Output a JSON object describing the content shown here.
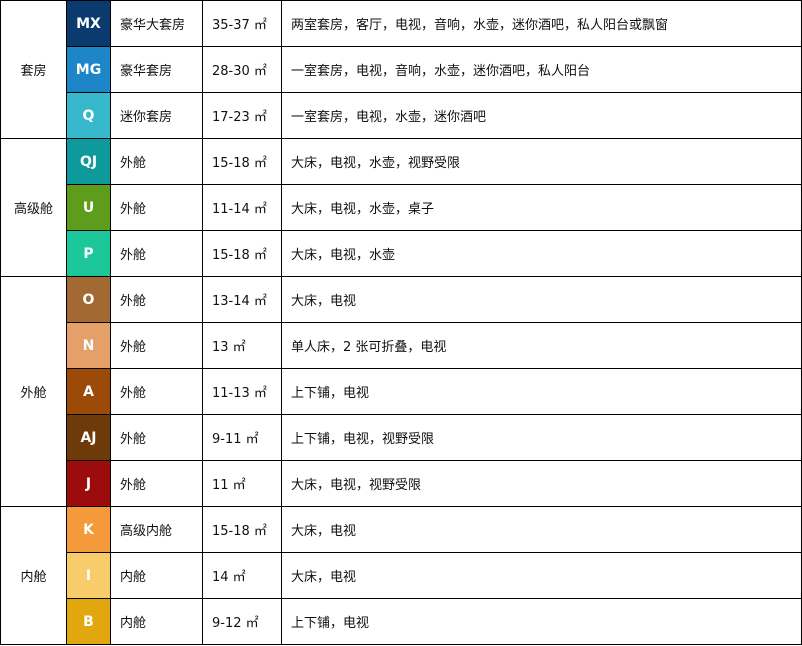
{
  "table": {
    "groups": [
      {
        "category": "套房",
        "rows": [
          {
            "code": "MX",
            "color": "#0b3a6e",
            "type": "豪华大套房",
            "size": "35-37 ㎡",
            "features": "两室套房，客厅，电视，音响，水壶，迷你酒吧，私人阳台或飘窗"
          },
          {
            "code": "MG",
            "color": "#1d86c8",
            "type": "豪华套房",
            "size": "28-30 ㎡",
            "features": "一室套房，电视，音响，水壶，迷你酒吧，私人阳台"
          },
          {
            "code": "Q",
            "color": "#38b8cc",
            "type": "迷你套房",
            "size": "17-23 ㎡",
            "features": "一室套房，电视，水壶，迷你酒吧"
          }
        ]
      },
      {
        "category": "高级舱",
        "rows": [
          {
            "code": "QJ",
            "color": "#0e9a9c",
            "type": "外舱",
            "size": "15-18 ㎡",
            "features": "大床，电视，水壶，视野受限"
          },
          {
            "code": "U",
            "color": "#5e9c1c",
            "type": "外舱",
            "size": "11-14 ㎡",
            "features": "大床，电视，水壶，桌子"
          },
          {
            "code": "P",
            "color": "#1cc89a",
            "type": "外舱",
            "size": "15-18 ㎡",
            "features": "大床，电视，水壶"
          }
        ]
      },
      {
        "category": "外舱",
        "rows": [
          {
            "code": "O",
            "color": "#a26a32",
            "type": "外舱",
            "size": "13-14 ㎡",
            "features": "大床，电视"
          },
          {
            "code": "N",
            "color": "#e5a06a",
            "type": "外舱",
            "size": "13 ㎡",
            "features": "单人床，2 张可折叠，电视"
          },
          {
            "code": "A",
            "color": "#9b4a08",
            "type": "外舱",
            "size": "11-13 ㎡",
            "features": "上下铺，电视"
          },
          {
            "code": "AJ",
            "color": "#6f3a0a",
            "type": "外舱",
            "size": "9-11 ㎡",
            "features": "上下铺，电视，视野受限"
          },
          {
            "code": "J",
            "color": "#9c0c0c",
            "type": "外舱",
            "size": "11 ㎡",
            "features": "大床，电视，视野受限"
          }
        ]
      },
      {
        "category": "内舱",
        "rows": [
          {
            "code": "K",
            "color": "#f59a3a",
            "type": "高级内舱",
            "size": "15-18 ㎡",
            "features": "大床，电视"
          },
          {
            "code": "I",
            "color": "#f8cc6a",
            "type": "内舱",
            "size": "14 ㎡",
            "features": "大床，电视"
          },
          {
            "code": "B",
            "color": "#e2a70e",
            "type": "内舱",
            "size": "9-12 ㎡",
            "features": "上下铺，电视"
          }
        ]
      }
    ]
  }
}
